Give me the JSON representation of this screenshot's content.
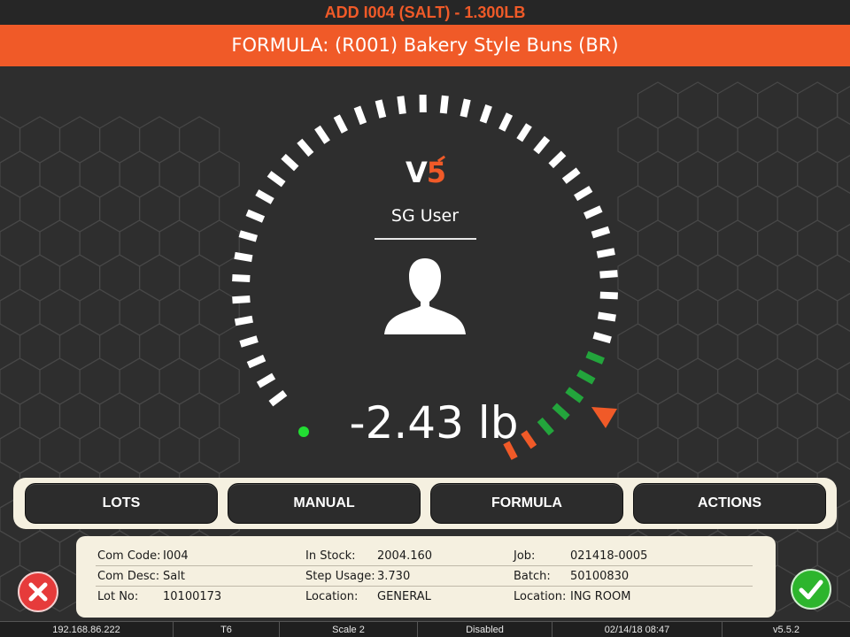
{
  "header": {
    "instruction": "ADD I004 (SALT) - 1.300LB",
    "formula": "FORMULA: (R001) Bakery Style Buns (BR)"
  },
  "colors": {
    "accent": "#f05a28",
    "background": "#2e2e2e",
    "panel": "#f5f0e0",
    "tolerance_green": "#23a53c",
    "indicator_green": "#22dd33",
    "danger": "#e63b3b",
    "ok": "#2db52d"
  },
  "logo": {
    "v": "V",
    "five": "5"
  },
  "user": {
    "name": "SG User",
    "icon": "user-silhouette-icon"
  },
  "scale": {
    "weight": "-2.43 lb",
    "target_marker_icon": "triangle-marker-icon"
  },
  "tabs": [
    {
      "label": "LOTS"
    },
    {
      "label": "MANUAL"
    },
    {
      "label": "FORMULA"
    },
    {
      "label": "ACTIONS"
    }
  ],
  "info": {
    "com_code_label": "Com Code:",
    "com_code": "I004",
    "com_desc_label": "Com Desc:",
    "com_desc": "Salt",
    "lot_no_label": "Lot No:",
    "lot_no": "10100173",
    "in_stock_label": "In Stock:",
    "in_stock": "2004.160",
    "step_usage_label": "Step Usage:",
    "step_usage": "3.730",
    "location_label": "Location:",
    "location": "GENERAL",
    "job_label": "Job:",
    "job": "021418-0005",
    "batch_label": "Batch:",
    "batch": "50100830",
    "location2_label": "Location:",
    "location2": "ING ROOM"
  },
  "buttons": {
    "cancel_icon": "close-icon",
    "confirm_icon": "check-icon"
  },
  "status": {
    "ip": "192.168.86.222",
    "terminal": "T6",
    "scale": "Scale 2",
    "mode": "Disabled",
    "datetime": "02/14/18 08:47",
    "version": "v5.5.2"
  }
}
